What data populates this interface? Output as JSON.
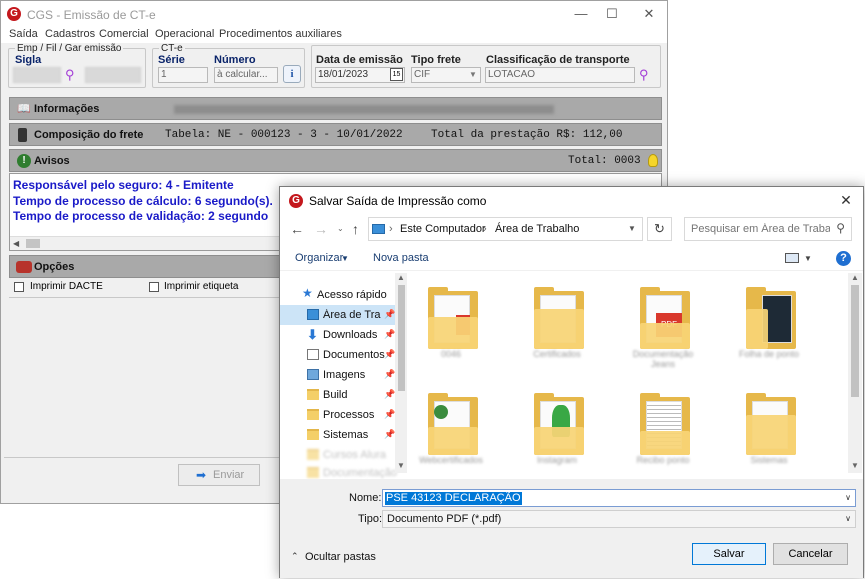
{
  "main_window": {
    "title": "CGS - Emissão de CT-e",
    "controls": {
      "minimize": "—",
      "maximize": "☐",
      "close": "✕"
    },
    "menu": [
      "Saída",
      "Cadastros",
      "Comercial",
      "Operacional",
      "Procedimentos auxiliares"
    ],
    "emp_group": {
      "legend": "Emp / Fil / Gar emissão",
      "sigla_label": "Sigla"
    },
    "cte_group": {
      "legend": "CT-e",
      "serie_label": "Série",
      "serie_value": "1",
      "numero_label": "Número",
      "numero_value": "à calcular..."
    },
    "data_emissao": {
      "label": "Data de emissão",
      "value": "18/01/2023"
    },
    "tipo_frete": {
      "label": "Tipo frete",
      "value": "CIF"
    },
    "classificacao": {
      "label": "Classificação de transporte",
      "value": "LOTACAO"
    },
    "informacoes": {
      "label": "Informações"
    },
    "composicao": {
      "label": "Composição do frete",
      "tabela": "Tabela: NE - 000123 - 3 - 10/01/2022",
      "total": "Total da prestação R$: 112,00"
    },
    "avisos": {
      "label": "Avisos",
      "total": "Total: 0003",
      "lines": [
        "Responsável pelo seguro: 4 - Emitente",
        "Tempo de processo de cálculo: 6 segundo(s).",
        "Tempo de processo de validação: 2 segundo"
      ]
    },
    "opcoes": {
      "label": "Opções",
      "imprimir_dacte": "Imprimir DACTE",
      "imprimir_etiqueta": "Imprimir etiqueta"
    },
    "enviar_label": "Enviar",
    "colors": {
      "bar_bg": "#a9a9a9",
      "aviso_text": "#1a1ac8",
      "label_blue": "#0a246a"
    }
  },
  "dialog": {
    "title": "Salvar Saída de Impressão como",
    "breadcrumb": [
      "Este Computador",
      "Área de Trabalho"
    ],
    "search_placeholder": "Pesquisar em Área de Trabalho",
    "organize_label": "Organizar",
    "new_folder_label": "Nova pasta",
    "nav_items": [
      {
        "label": "Acesso rápido",
        "icon": "star-icon"
      },
      {
        "label": "Área de Trabalho",
        "icon": "desktop-icon",
        "pinned": true,
        "selected": true
      },
      {
        "label": "Downloads",
        "icon": "download-arrow-icon",
        "pinned": true
      },
      {
        "label": "Documentos",
        "icon": "documents-icon",
        "pinned": true
      },
      {
        "label": "Imagens",
        "icon": "images-icon",
        "pinned": true
      },
      {
        "label": "Build",
        "icon": "folder-icon",
        "pinned": true
      },
      {
        "label": "Processos",
        "icon": "folder-icon",
        "pinned": true
      },
      {
        "label": "Sistemas",
        "icon": "folder-icon",
        "pinned": true
      },
      {
        "label": "Cursos Alura",
        "icon": "folder-icon",
        "blurred": true
      },
      {
        "label": "Documentação",
        "icon": "folder-icon",
        "blurred": true
      }
    ],
    "files": [
      {
        "name": "0046",
        "kind": "pdf-folder"
      },
      {
        "name": "Certificados",
        "kind": "folder"
      },
      {
        "name": "Documentação Jeans",
        "kind": "pdf-folder"
      },
      {
        "name": "Folha de ponto",
        "kind": "dark-folder"
      },
      {
        "name": "Webcertificados",
        "kind": "web-folder"
      },
      {
        "name": "Instagram",
        "kind": "green-folder"
      },
      {
        "name": "Recibo ponto",
        "kind": "doc-folder"
      },
      {
        "name": "Sistemas",
        "kind": "folder"
      }
    ],
    "name_label": "Nome:",
    "name_value": "PSE 43123 DECLARAÇÃO",
    "type_label": "Tipo:",
    "type_value": "Documento PDF (*.pdf)",
    "hide_folders_label": "Ocultar pastas",
    "save_label": "Salvar",
    "cancel_label": "Cancelar",
    "close_glyph": "✕"
  }
}
